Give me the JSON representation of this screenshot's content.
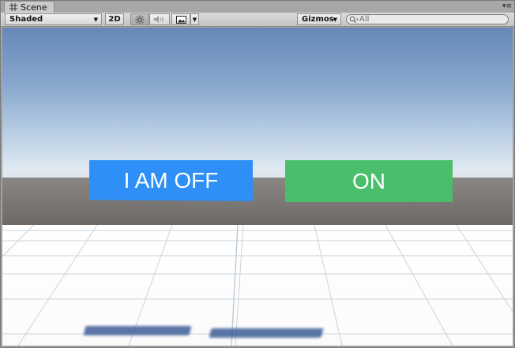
{
  "tab": {
    "title": "Scene",
    "icon": "grid-icon",
    "menu_icon": "panel-menu-icon"
  },
  "toolbar": {
    "shading_mode": "Shaded",
    "mode_2d": "2D",
    "lighting_icon": "sun-icon",
    "audio_icon": "speaker-icon",
    "effects_icon": "image-icon",
    "gizmos_label": "Gizmos",
    "search_icon": "search-icon",
    "search_placeholder": "All"
  },
  "scene": {
    "buttons": [
      {
        "label": "I AM OFF",
        "color": "#2e8ff6"
      },
      {
        "label": "ON",
        "color": "#4bbe6b"
      }
    ]
  }
}
